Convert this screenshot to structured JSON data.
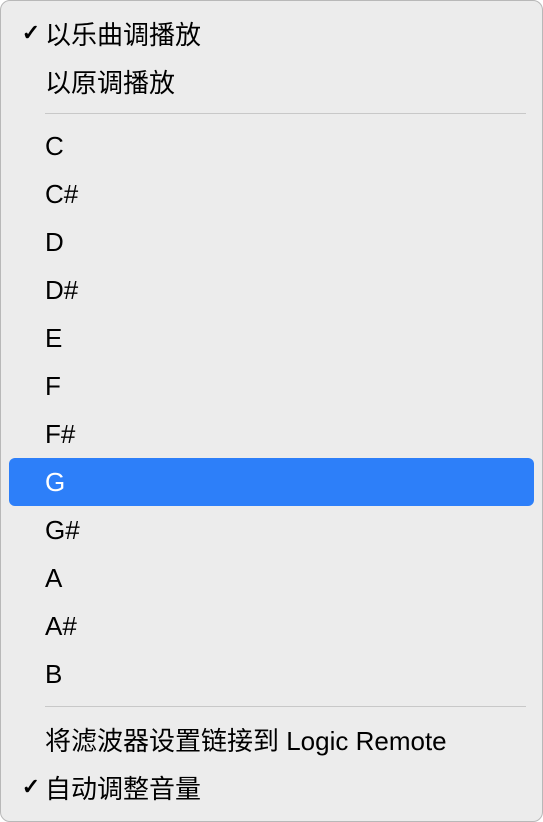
{
  "section1": {
    "items": [
      {
        "label": "以乐曲调播放",
        "checked": true
      },
      {
        "label": "以原调播放",
        "checked": false
      }
    ]
  },
  "section2": {
    "keys": [
      {
        "label": "C",
        "highlighted": false
      },
      {
        "label": "C#",
        "highlighted": false
      },
      {
        "label": "D",
        "highlighted": false
      },
      {
        "label": "D#",
        "highlighted": false
      },
      {
        "label": "E",
        "highlighted": false
      },
      {
        "label": "F",
        "highlighted": false
      },
      {
        "label": "F#",
        "highlighted": false
      },
      {
        "label": "G",
        "highlighted": true
      },
      {
        "label": "G#",
        "highlighted": false
      },
      {
        "label": "A",
        "highlighted": false
      },
      {
        "label": "A#",
        "highlighted": false
      },
      {
        "label": "B",
        "highlighted": false
      }
    ]
  },
  "section3": {
    "items": [
      {
        "label": "将滤波器设置链接到 Logic Remote",
        "checked": false
      },
      {
        "label": "自动调整音量",
        "checked": true
      }
    ]
  }
}
